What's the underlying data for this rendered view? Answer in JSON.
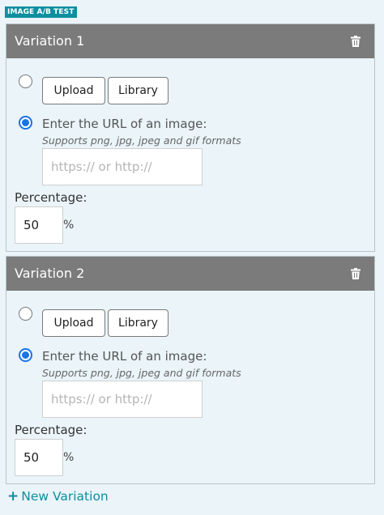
{
  "badge": "IMAGE A/B TEST",
  "variations": [
    {
      "title": "Variation 1",
      "upload_label": "Upload",
      "library_label": "Library",
      "url_label": "Enter the URL of an image:",
      "url_hint": "Supports png, jpg, jpeg and gif formats",
      "url_placeholder": "https:// or http://",
      "url_value": "",
      "source_selected": "url",
      "percentage_label": "Percentage:",
      "percentage_value": "50",
      "percent_sign": "%",
      "delete_icon": "trash-icon"
    },
    {
      "title": "Variation 2",
      "upload_label": "Upload",
      "library_label": "Library",
      "url_label": "Enter the URL of an image:",
      "url_hint": "Supports png, jpg, jpeg and gif formats",
      "url_placeholder": "https:// or http://",
      "url_value": "",
      "source_selected": "url",
      "percentage_label": "Percentage:",
      "percentage_value": "50",
      "percent_sign": "%",
      "delete_icon": "trash-icon"
    }
  ],
  "new_variation": {
    "icon": "plus-icon",
    "label": "New Variation"
  },
  "colors": {
    "accent": "#0e8ea0",
    "header_bg": "#7b7b7b",
    "panel_bg": "#eaf4f9",
    "radio_selected": "#1a73e8"
  }
}
